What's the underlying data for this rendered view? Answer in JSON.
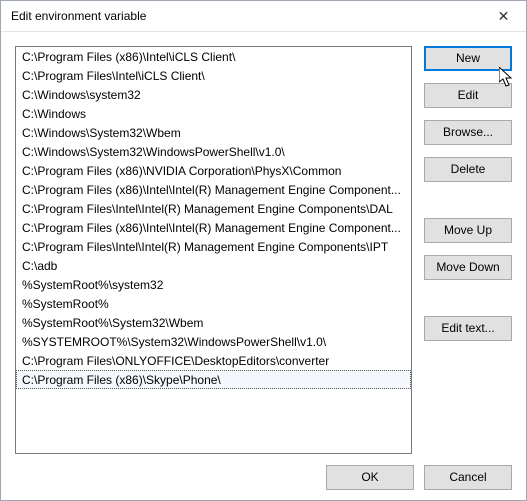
{
  "window": {
    "title": "Edit environment variable",
    "close_glyph": "✕"
  },
  "entries": [
    "C:\\Program Files (x86)\\Intel\\iCLS Client\\",
    "C:\\Program Files\\Intel\\iCLS Client\\",
    "C:\\Windows\\system32",
    "C:\\Windows",
    "C:\\Windows\\System32\\Wbem",
    "C:\\Windows\\System32\\WindowsPowerShell\\v1.0\\",
    "C:\\Program Files (x86)\\NVIDIA Corporation\\PhysX\\Common",
    "C:\\Program Files (x86)\\Intel\\Intel(R) Management Engine Component...",
    "C:\\Program Files\\Intel\\Intel(R) Management Engine Components\\DAL",
    "C:\\Program Files (x86)\\Intel\\Intel(R) Management Engine Component...",
    "C:\\Program Files\\Intel\\Intel(R) Management Engine Components\\IPT",
    "C:\\adb",
    "%SystemRoot%\\system32",
    "%SystemRoot%",
    "%SystemRoot%\\System32\\Wbem",
    "%SYSTEMROOT%\\System32\\WindowsPowerShell\\v1.0\\",
    "C:\\Program Files\\ONLYOFFICE\\DesktopEditors\\converter",
    "C:\\Program Files (x86)\\Skype\\Phone\\"
  ],
  "selected_index": 17,
  "buttons": {
    "new": "New",
    "edit": "Edit",
    "browse": "Browse...",
    "delete": "Delete",
    "move_up": "Move Up",
    "move_down": "Move Down",
    "edit_text": "Edit text...",
    "ok": "OK",
    "cancel": "Cancel"
  },
  "focused_button": "new"
}
